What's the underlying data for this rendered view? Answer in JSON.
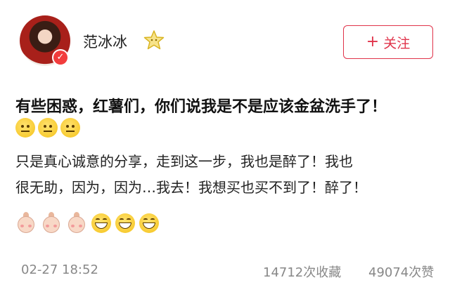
{
  "user": {
    "name": "范冰冰",
    "verified_mark": "✓",
    "avatar": "avatar-photo",
    "badge_icon": "star-icon"
  },
  "follow_button": {
    "label": "关注",
    "icon": "plus-icon",
    "color": "#e0334a"
  },
  "post": {
    "title": "有些困惑，红薯们，你们说我是不是应该金盆洗手了！",
    "title_emojis": [
      "neutral-face-emoji",
      "neutral-face-emoji",
      "neutral-face-emoji"
    ],
    "body_lines": [
      "只是真心诚意的分享，走到这一步，我也是醉了！我也",
      "很无助，因为，因为…我去！我想买也买不到了！醉了！"
    ],
    "body_emojis": [
      "shy-doll-emoji",
      "shy-doll-emoji",
      "shy-doll-emoji",
      "grin-emoji",
      "grin-emoji",
      "grin-emoji"
    ]
  },
  "footer": {
    "timestamp": "02-27 18:52",
    "favorites": "14712次收藏",
    "likes": "49074次赞"
  }
}
